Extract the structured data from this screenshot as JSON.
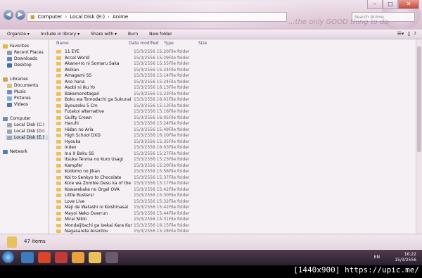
{
  "window": {
    "address_parts": [
      "Computer",
      "Local Disk (E:)",
      "Anime"
    ],
    "search_placeholder": "Search Anime",
    "motto": "...the only GOOD thing to do"
  },
  "toolbar": {
    "organize": "Organize ▾",
    "include": "Include in library ▾",
    "share": "Share with ▾",
    "burn": "Burn",
    "new_folder": "New folder"
  },
  "nav": {
    "favorites": "Favorites",
    "recent": "Recent Places",
    "downloads": "Downloads",
    "desktop": "Desktop",
    "libraries": "Libraries",
    "documents": "Documents",
    "music": "Music",
    "pictures": "Pictures",
    "videos": "Videos",
    "computer": "Computer",
    "disk_c": "Local Disk (C:)",
    "disk_d": "Local Disk (D:)",
    "disk_e": "Local Disk (E:)",
    "network": "Network"
  },
  "columns": {
    "name": "Name",
    "date": "Date modified",
    "type": "Type",
    "size": "Size"
  },
  "files": [
    {
      "name": "11 EYE",
      "date": "15/3/2556 15:20",
      "type": "File folder"
    },
    {
      "name": "Accel World",
      "date": "15/3/2556 15:29",
      "type": "File folder"
    },
    {
      "name": "Akane-Iro ni Somaru Saka",
      "date": "15/3/2556 15:55",
      "type": "File folder"
    },
    {
      "name": "Akikan",
      "date": "15/3/2556 15:24",
      "type": "File folder"
    },
    {
      "name": "Amagami SS",
      "date": "15/3/2556 15:14",
      "type": "File folder"
    },
    {
      "name": "Ano hana",
      "date": "15/3/2556 15:24",
      "type": "File folder"
    },
    {
      "name": "Asobi ni Iku Yo",
      "date": "15/3/2556 16:13",
      "type": "File folder"
    },
    {
      "name": "Bakemonotagari",
      "date": "15/3/2556 15:23",
      "type": "File folder"
    },
    {
      "name": "Boku wa Tomodachi ga Sukunai NEX...",
      "date": "15/3/2556 16:01",
      "type": "File folder"
    },
    {
      "name": "Byousoku 5 Cm",
      "date": "15/3/2556 15:13",
      "type": "File folder"
    },
    {
      "name": "Futakoi alternative",
      "date": "15/3/2556 15:16",
      "type": "File folder"
    },
    {
      "name": "Guilty Crown",
      "date": "15/3/2556 16:05",
      "type": "File folder"
    },
    {
      "name": "Haruhi",
      "date": "15/3/2556 15:24",
      "type": "File folder"
    },
    {
      "name": "Hidan no Aria",
      "date": "15/3/2556 15:49",
      "type": "File folder"
    },
    {
      "name": "High School DXD",
      "date": "15/3/2556 16:20",
      "type": "File folder"
    },
    {
      "name": "Hyouka",
      "date": "15/3/2556 15:35",
      "type": "File folder"
    },
    {
      "name": "Index",
      "date": "15/3/2556 16:03",
      "type": "File folder"
    },
    {
      "name": "Inu X Boku SS",
      "date": "15/3/2556 15:27",
      "type": "File folder"
    },
    {
      "name": "Itsuka Tenma no Kuro Usagi",
      "date": "15/3/2556 15:23",
      "type": "File folder"
    },
    {
      "name": "Kampfer",
      "date": "15/3/2556 15:20",
      "type": "File folder"
    },
    {
      "name": "Kodomo no Jikan",
      "date": "15/3/2556 15:56",
      "type": "File folder"
    },
    {
      "name": "Koi to Senkyo to Chocolate",
      "date": "15/3/2556 15:37",
      "type": "File folder"
    },
    {
      "name": "Kore wa Zombie Desu ka of the Dead",
      "date": "15/3/2556 15:17",
      "type": "File folder"
    },
    {
      "name": "Kowarekake no Orgel OVA",
      "date": "15/3/2556 15:42",
      "type": "File folder"
    },
    {
      "name": "Little Busters!",
      "date": "15/3/2556 15:30",
      "type": "File folder"
    },
    {
      "name": "Love Live",
      "date": "15/3/2556 15:32",
      "type": "File folder"
    },
    {
      "name": "Maji de Watashi ni Koishinasai",
      "date": "15/3/2556 15:42",
      "type": "File folder"
    },
    {
      "name": "Mayoi Neko Overrun",
      "date": "15/3/2556 15:44",
      "type": "File folder"
    },
    {
      "name": "Mirai Nikki",
      "date": "15/3/2556 15:31",
      "type": "File folder"
    },
    {
      "name": "Mondaijitachi ga Isekai Kara Kuru So...",
      "date": "15/3/2556 16:15",
      "type": "File folder"
    },
    {
      "name": "Nagasarete Airantou",
      "date": "15/3/2556 15:28",
      "type": "File folder"
    }
  ],
  "status": {
    "count": "47 items"
  },
  "taskbar": {
    "lang": "EN",
    "time": "16:22",
    "date": "15/3/2556"
  },
  "watermark": "[1440x900] https://upic.me/"
}
